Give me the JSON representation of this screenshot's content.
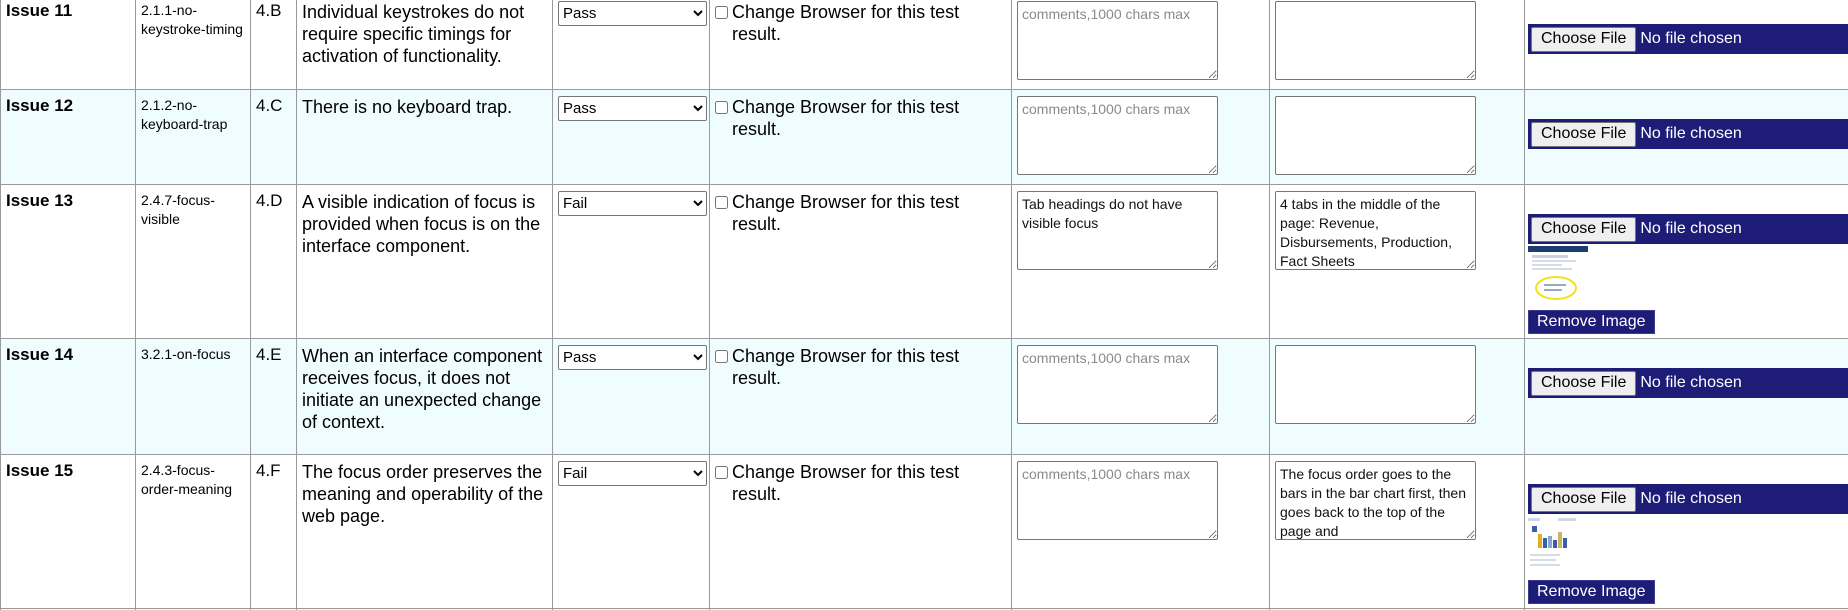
{
  "result_options": [
    "Pass",
    "Fail"
  ],
  "change_browser_label": "Change Browser for this test result.",
  "comment_placeholder": "comments,1000 chars max",
  "file_button_label": "Choose File",
  "no_file_label": "No file chosen",
  "remove_image_label": "Remove Image",
  "rows": [
    {
      "issue": "Issue 11",
      "sc": "2.1.1-no-keystroke-timing",
      "ref": "4.B",
      "description": "Individual keystrokes do not require specific timings for activation of functionality.",
      "result": "Pass",
      "change_browser_checked": false,
      "comment": "",
      "notes": "",
      "has_image": false
    },
    {
      "issue": "Issue 12",
      "sc": "2.1.2-no-keyboard-trap",
      "ref": "4.C",
      "description": "There is no keyboard trap.",
      "result": "Pass",
      "change_browser_checked": false,
      "comment": "",
      "notes": "",
      "has_image": false
    },
    {
      "issue": "Issue 13",
      "sc": "2.4.7-focus-visible",
      "ref": "4.D",
      "description": "A visible indication of focus is provided when focus is on the interface component.",
      "result": "Fail",
      "change_browser_checked": false,
      "comment": "Tab headings do not have visible focus",
      "notes": "4 tabs in the middle of the page: Revenue, Disbursements, Production, Fact Sheets",
      "has_image": true
    },
    {
      "issue": "Issue 14",
      "sc": "3.2.1-on-focus",
      "ref": "4.E",
      "description": "When an interface component receives focus, it does not initiate an unexpected change of context.",
      "result": "Pass",
      "change_browser_checked": false,
      "comment": "",
      "notes": "",
      "has_image": false
    },
    {
      "issue": "Issue 15",
      "sc": "2.4.3-focus-order-meaning",
      "ref": "4.F",
      "description": "The focus order preserves the meaning and operability of the web page.",
      "result": "Fail",
      "change_browser_checked": false,
      "comment": "",
      "notes": "The focus order goes to the bars in the bar chart first, then goes back to the top of the page and",
      "has_image": true
    }
  ]
}
